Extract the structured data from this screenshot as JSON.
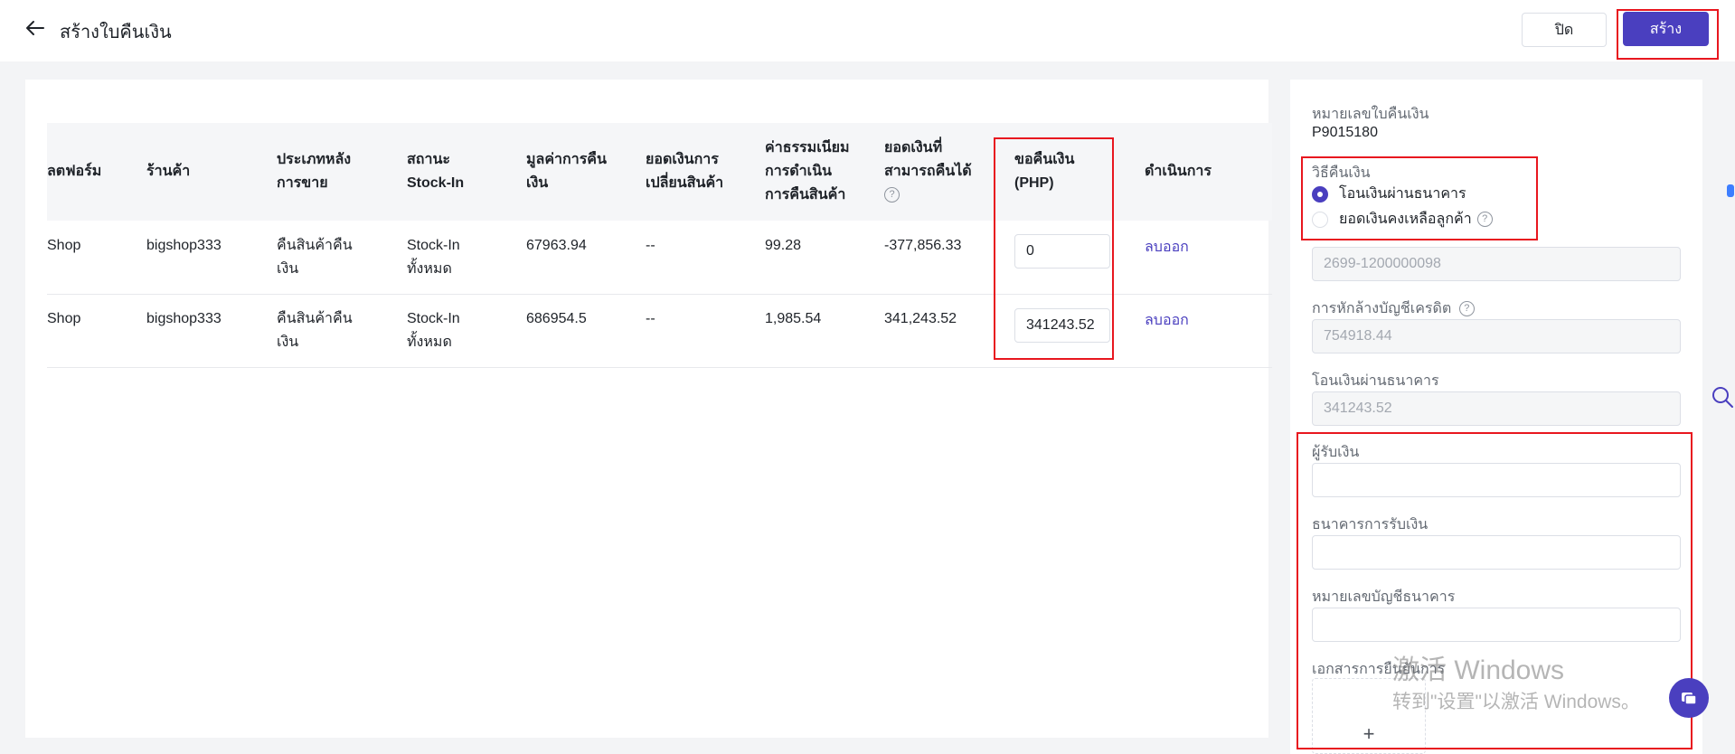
{
  "header": {
    "title": "สร้างใบคืนเงิน",
    "close_label": "ปิด",
    "create_label": "สร้าง"
  },
  "table": {
    "headers": {
      "platform": "ลตฟอร์ม",
      "shop": "ร้านค้า",
      "after_sales_l1": "ประเภทหลัง",
      "after_sales_l2": "การขาย",
      "stockin_l1": "สถานะ",
      "stockin_l2": "Stock-In",
      "refund_value_l1": "มูลค่าการคืน",
      "refund_value_l2": "เงิน",
      "exchange_l1": "ยอดเงินการ",
      "exchange_l2": "เปลี่ยนสินค้า",
      "fee_l1": "ค่าธรรมเนียม",
      "fee_l2": "การดำเนิน",
      "fee_l3": "การคืนสินค้า",
      "refundable_l1": "ยอดเงินที่",
      "refundable_l2": "สามารถคืนได้",
      "request_l1": "ขอคืนเงิน",
      "request_l2": "(PHP)",
      "action": "ดำเนินการ"
    },
    "rows": [
      {
        "platform": "Shop",
        "shop": "bigshop333",
        "after_sales_l1": "คืนสินค้าคืน",
        "after_sales_l2": "เงิน",
        "stockin_l1": "Stock-In",
        "stockin_l2": "ทั้งหมด",
        "refund_value": "67963.94",
        "exchange": "--",
        "fee": "99.28",
        "refundable": "-377,856.33",
        "request": "0",
        "action": "ลบออก"
      },
      {
        "platform": "Shop",
        "shop": "bigshop333",
        "after_sales_l1": "คืนสินค้าคืน",
        "after_sales_l2": "เงิน",
        "stockin_l1": "Stock-In",
        "stockin_l2": "ทั้งหมด",
        "refund_value": "686954.5",
        "exchange": "--",
        "fee": "1,985.54",
        "refundable": "341,243.52",
        "request": "341243.52",
        "action": "ลบออก"
      }
    ]
  },
  "sidebar": {
    "refund_no_label": "หมายเลขใบคืนเงิน",
    "refund_no_value": "P9015180",
    "method_label": "วิธีคืนเงิน",
    "method_option_bank": "โอนเงินผ่านธนาคาร",
    "method_option_balance": "ยอดเงินคงเหลือลูกค้า",
    "account_value": "2699-1200000098",
    "credit_offset_label": "การหักล้างบัญชีเครดิต",
    "credit_offset_value": "754918.44",
    "bank_transfer_label": "โอนเงินผ่านธนาคาร",
    "bank_transfer_value": "341243.52",
    "payee_label": "ผู้รับเงิน",
    "payee_value": "",
    "receiving_bank_label": "ธนาคารการรับเงิน",
    "receiving_bank_value": "",
    "bank_account_label": "หมายเลขบัญชีธนาคาร",
    "bank_account_value": "",
    "documents_label": "เอกสารการยืนยันการ",
    "upload_plus": "+"
  },
  "watermark": {
    "line1": "激活 Windows",
    "line2": "转到\"设置\"以激活 Windows。"
  },
  "colors": {
    "accent": "#4a3fbf",
    "highlight": "#e8171f"
  }
}
